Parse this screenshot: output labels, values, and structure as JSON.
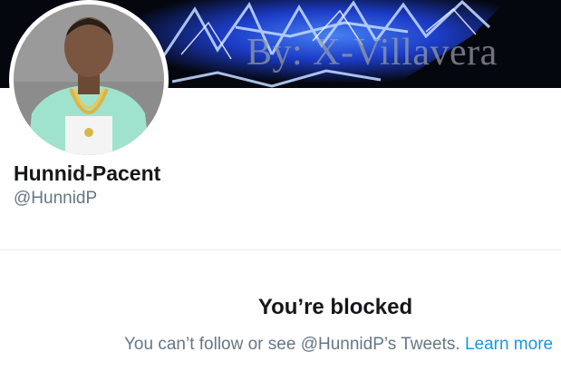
{
  "banner": {
    "text": "By: X-Villavera"
  },
  "profile": {
    "display_name": "Hunnid-Pacent",
    "handle": "@HunnidP"
  },
  "blocked": {
    "title": "You’re blocked",
    "message": "You can’t follow or see @HunnidP’s Tweets.",
    "learn_more": "Learn more"
  },
  "colors": {
    "link": "#1b95e0",
    "secondary_text": "#657786",
    "primary_text": "#14171a",
    "divider": "#e6ecf0"
  }
}
